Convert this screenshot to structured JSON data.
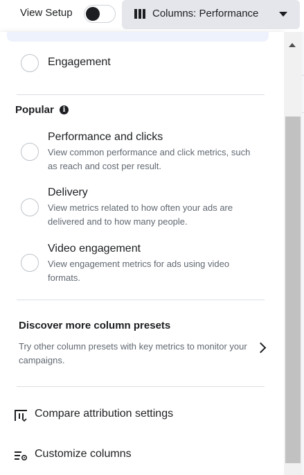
{
  "topbar": {
    "view_setup_label": "View Setup",
    "view_setup_on": false,
    "columns_button_label": "Columns: Performance"
  },
  "options_above": [
    {
      "title": "Engagement",
      "selected": false
    }
  ],
  "popular": {
    "heading": "Popular",
    "info_icon": "i",
    "options": [
      {
        "title": "Performance and clicks",
        "description": "View common performance and click metrics, such as reach and cost per result.",
        "selected": false
      },
      {
        "title": "Delivery",
        "description": "View metrics related to how often your ads are delivered and to how many people.",
        "selected": false
      },
      {
        "title": "Video engagement",
        "description": "View engagement metrics for ads using video formats.",
        "selected": false
      }
    ]
  },
  "discover": {
    "title": "Discover more column presets",
    "description": "Try other column presets with key metrics to monitor your campaigns."
  },
  "actions": [
    {
      "label": "Compare attribution settings",
      "icon": "compare-attribution-icon"
    },
    {
      "label": "Customize columns",
      "icon": "customize-columns-icon"
    }
  ],
  "colors": {
    "button_bg": "#e4e6eb",
    "text_primary": "#1c1e21",
    "text_secondary": "#606770",
    "divider": "#dadde1",
    "radio_border": "#bec3c9"
  }
}
